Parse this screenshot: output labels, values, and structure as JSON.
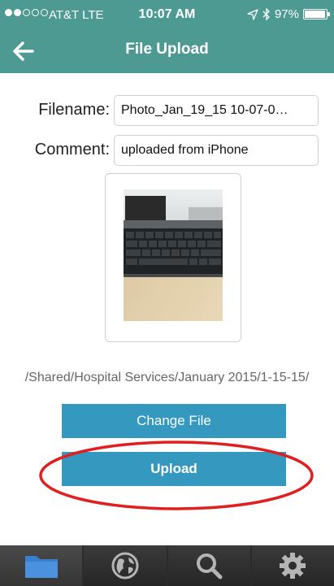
{
  "status_bar": {
    "signal_dots_filled": 2,
    "signal_dots_total": 5,
    "carrier": "AT&T  LTE",
    "time": "10:07 AM",
    "battery": "97%",
    "battery_level": 0.97
  },
  "nav": {
    "back_icon": "arrow-left-icon",
    "title": "File Upload"
  },
  "form": {
    "filename_label": "Filename:",
    "filename_value": "Photo_Jan_19_15 10-07-0…",
    "comment_label": "Comment:",
    "comment_value": "uploaded from iPhone"
  },
  "preview": {
    "icon": "photo-thumbnail-keyboard"
  },
  "folder_path": "/Shared/Hospital Services/January 2015/1-15-15/",
  "buttons": {
    "change_file": "Change File",
    "upload": "Upload"
  },
  "tab_bar": {
    "tabs": [
      {
        "icon": "folder-icon",
        "active": true
      },
      {
        "icon": "globe-icon",
        "active": false
      },
      {
        "icon": "search-icon",
        "active": false
      },
      {
        "icon": "gear-icon",
        "active": false
      }
    ]
  },
  "colors": {
    "header": "#4d9a92",
    "button": "#3498bf",
    "annotation": "#e02020",
    "tab_bar": "#2b2b2b",
    "folder_icon": "#3a7fcf"
  }
}
